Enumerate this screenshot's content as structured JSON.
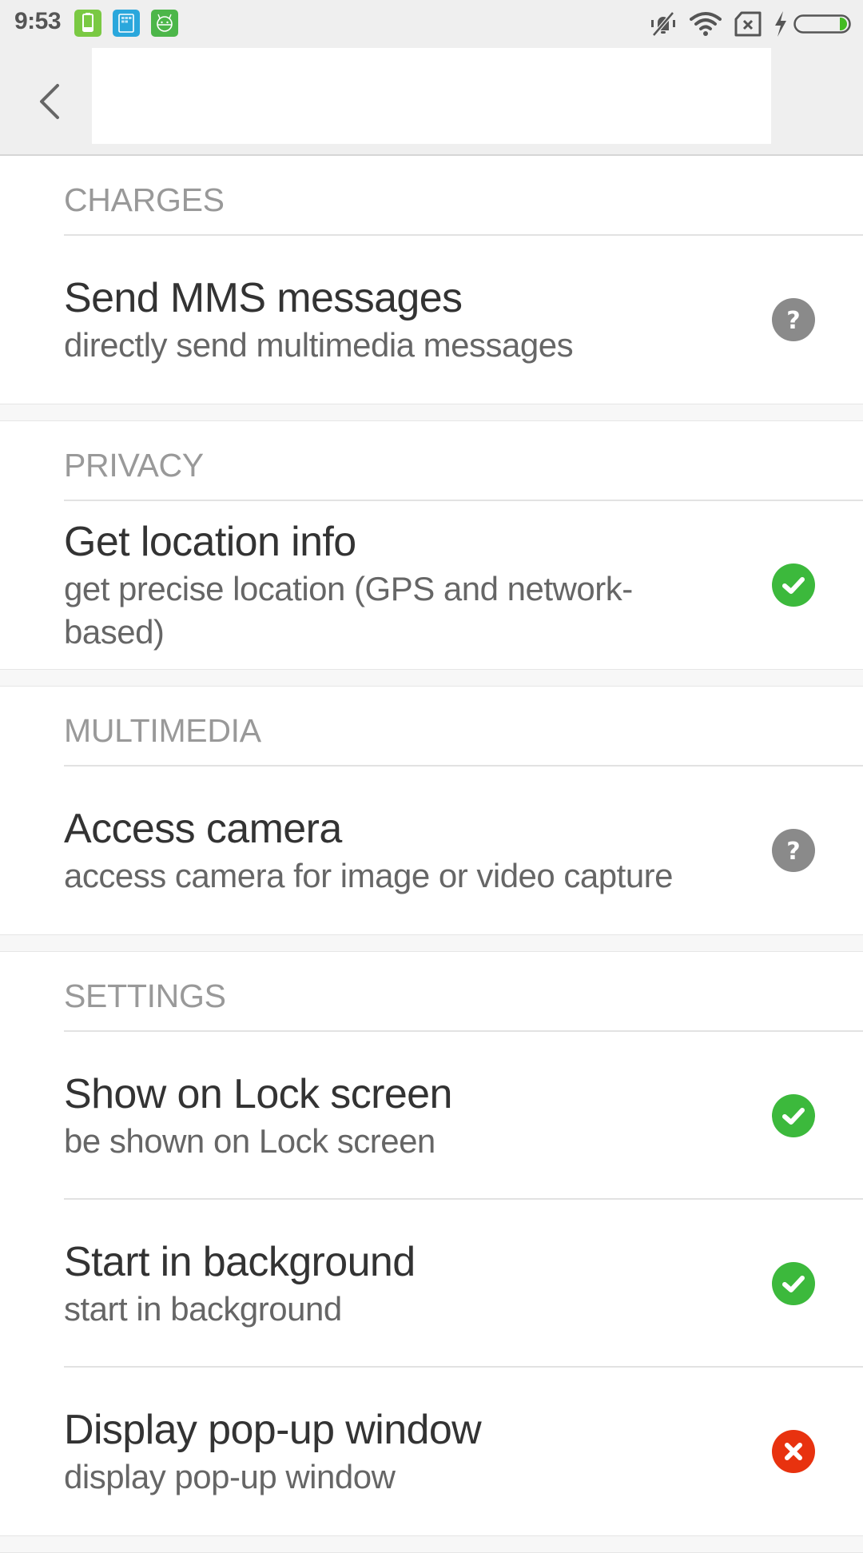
{
  "status_bar": {
    "time": "9:53",
    "notification_icons": [
      {
        "name": "battery-app-icon",
        "color": "#7ac943"
      },
      {
        "name": "grid-app-icon",
        "color": "#2aa7dc"
      },
      {
        "name": "android-app-icon",
        "color": "#4cb649"
      }
    ],
    "system_icons": [
      "bell-off-icon",
      "wifi-icon",
      "no-sim-icon",
      "charging-bolt-icon",
      "battery-icon"
    ],
    "battery_level_percent": 15,
    "battery_fill_color": "#44bb22"
  },
  "header": {
    "back_icon": "chevron-left-icon",
    "title": ""
  },
  "colors": {
    "allowed": "#3cb93c",
    "ask": "#8a8a8a",
    "denied": "#e8320f"
  },
  "sections": [
    {
      "label": "CHARGES",
      "items": [
        {
          "title": "Send MMS messages",
          "subtitle": "directly send multimedia messages",
          "state": "ask"
        }
      ]
    },
    {
      "label": "PRIVACY",
      "items": [
        {
          "title": "Get location info",
          "subtitle": "get precise location (GPS and network-\nbased)",
          "state": "allowed"
        }
      ]
    },
    {
      "label": "MULTIMEDIA",
      "items": [
        {
          "title": "Access camera",
          "subtitle": "access camera for image or video capture",
          "state": "ask"
        }
      ]
    },
    {
      "label": "SETTINGS",
      "items": [
        {
          "title": "Show on Lock screen",
          "subtitle": "be shown on Lock screen",
          "state": "allowed"
        },
        {
          "title": "Start in background",
          "subtitle": "start in background",
          "state": "allowed"
        },
        {
          "title": "Display pop-up window",
          "subtitle": "display pop-up window",
          "state": "denied"
        }
      ]
    }
  ]
}
